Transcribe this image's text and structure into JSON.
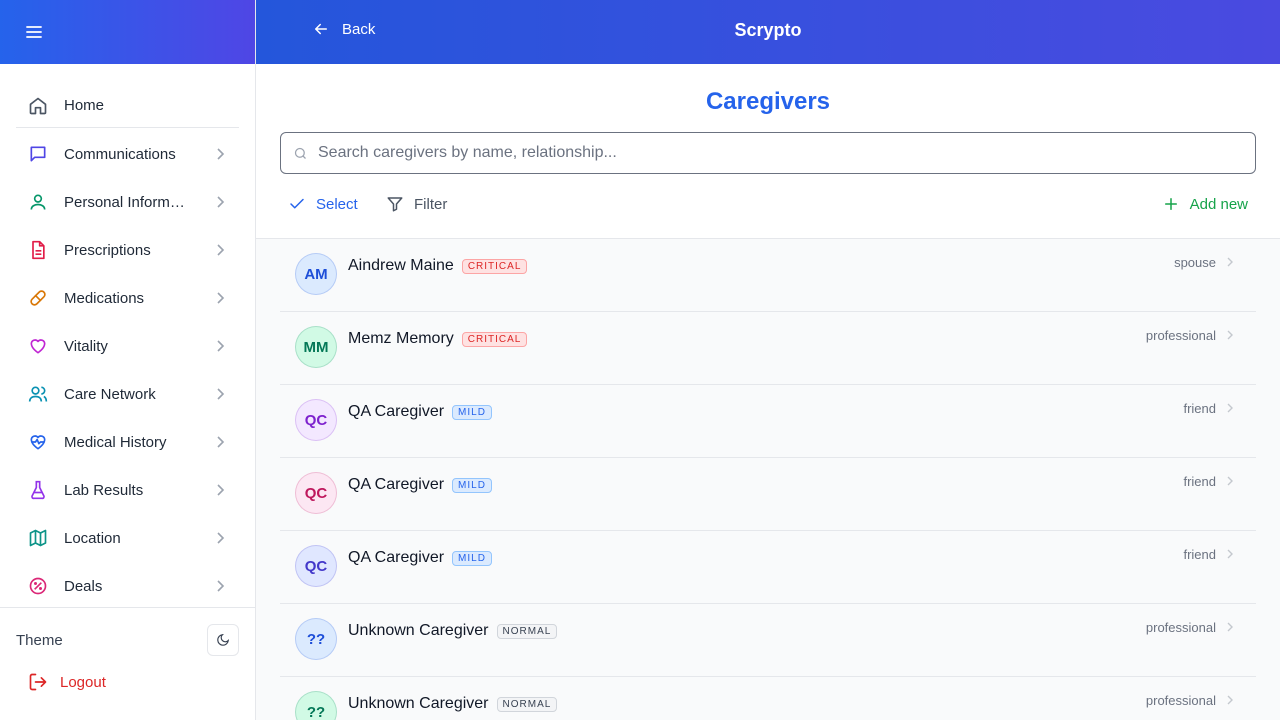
{
  "sidebar": {
    "items": [
      {
        "label": "Home",
        "icon": "home-icon",
        "color": "#4b5563"
      },
      {
        "label": "Communications",
        "icon": "message-icon",
        "color": "#4f46e5"
      },
      {
        "label": "Personal Information",
        "icon": "user-icon",
        "color": "#059669"
      },
      {
        "label": "Prescriptions",
        "icon": "document-icon",
        "color": "#e11d48"
      },
      {
        "label": "Medications",
        "icon": "pill-icon",
        "color": "#d97706"
      },
      {
        "label": "Vitality",
        "icon": "heart-icon",
        "color": "#c026d3"
      },
      {
        "label": "Care Network",
        "icon": "users-icon",
        "color": "#0891b2"
      },
      {
        "label": "Medical History",
        "icon": "heart-pulse-icon",
        "color": "#2563eb"
      },
      {
        "label": "Lab Results",
        "icon": "flask-icon",
        "color": "#9333ea"
      },
      {
        "label": "Location",
        "icon": "map-icon",
        "color": "#0d9488"
      },
      {
        "label": "Deals",
        "icon": "discount-icon",
        "color": "#db2777"
      }
    ],
    "theme_label": "Theme",
    "logout_label": "Logout"
  },
  "header": {
    "back_label": "Back",
    "app_title": "Scrypto"
  },
  "main": {
    "title": "Caregivers",
    "search_placeholder": "Search caregivers by name, relationship...",
    "select_label": "Select",
    "filter_label": "Filter",
    "add_label": "Add new"
  },
  "caregivers": [
    {
      "initials": "AM",
      "name": "Aindrew Maine",
      "severity": "CRITICAL",
      "relation": "spouse",
      "avatar_bg": "#dbeafe",
      "avatar_fg": "#1d4ed8"
    },
    {
      "initials": "MM",
      "name": "Memz Memory",
      "severity": "CRITICAL",
      "relation": "professional",
      "avatar_bg": "#d1fae5",
      "avatar_fg": "#047857"
    },
    {
      "initials": "QC",
      "name": "QA Caregiver",
      "severity": "MILD",
      "relation": "friend",
      "avatar_bg": "#f3e8ff",
      "avatar_fg": "#7e22ce"
    },
    {
      "initials": "QC",
      "name": "QA Caregiver",
      "severity": "MILD",
      "relation": "friend",
      "avatar_bg": "#fce7f3",
      "avatar_fg": "#be185d"
    },
    {
      "initials": "QC",
      "name": "QA Caregiver",
      "severity": "MILD",
      "relation": "friend",
      "avatar_bg": "#e0e7ff",
      "avatar_fg": "#4338ca"
    },
    {
      "initials": "??",
      "name": "Unknown Caregiver",
      "severity": "NORMAL",
      "relation": "professional",
      "avatar_bg": "#dbeafe",
      "avatar_fg": "#1d4ed8"
    },
    {
      "initials": "??",
      "name": "Unknown Caregiver",
      "severity": "NORMAL",
      "relation": "professional",
      "avatar_bg": "#d1fae5",
      "avatar_fg": "#047857"
    }
  ]
}
